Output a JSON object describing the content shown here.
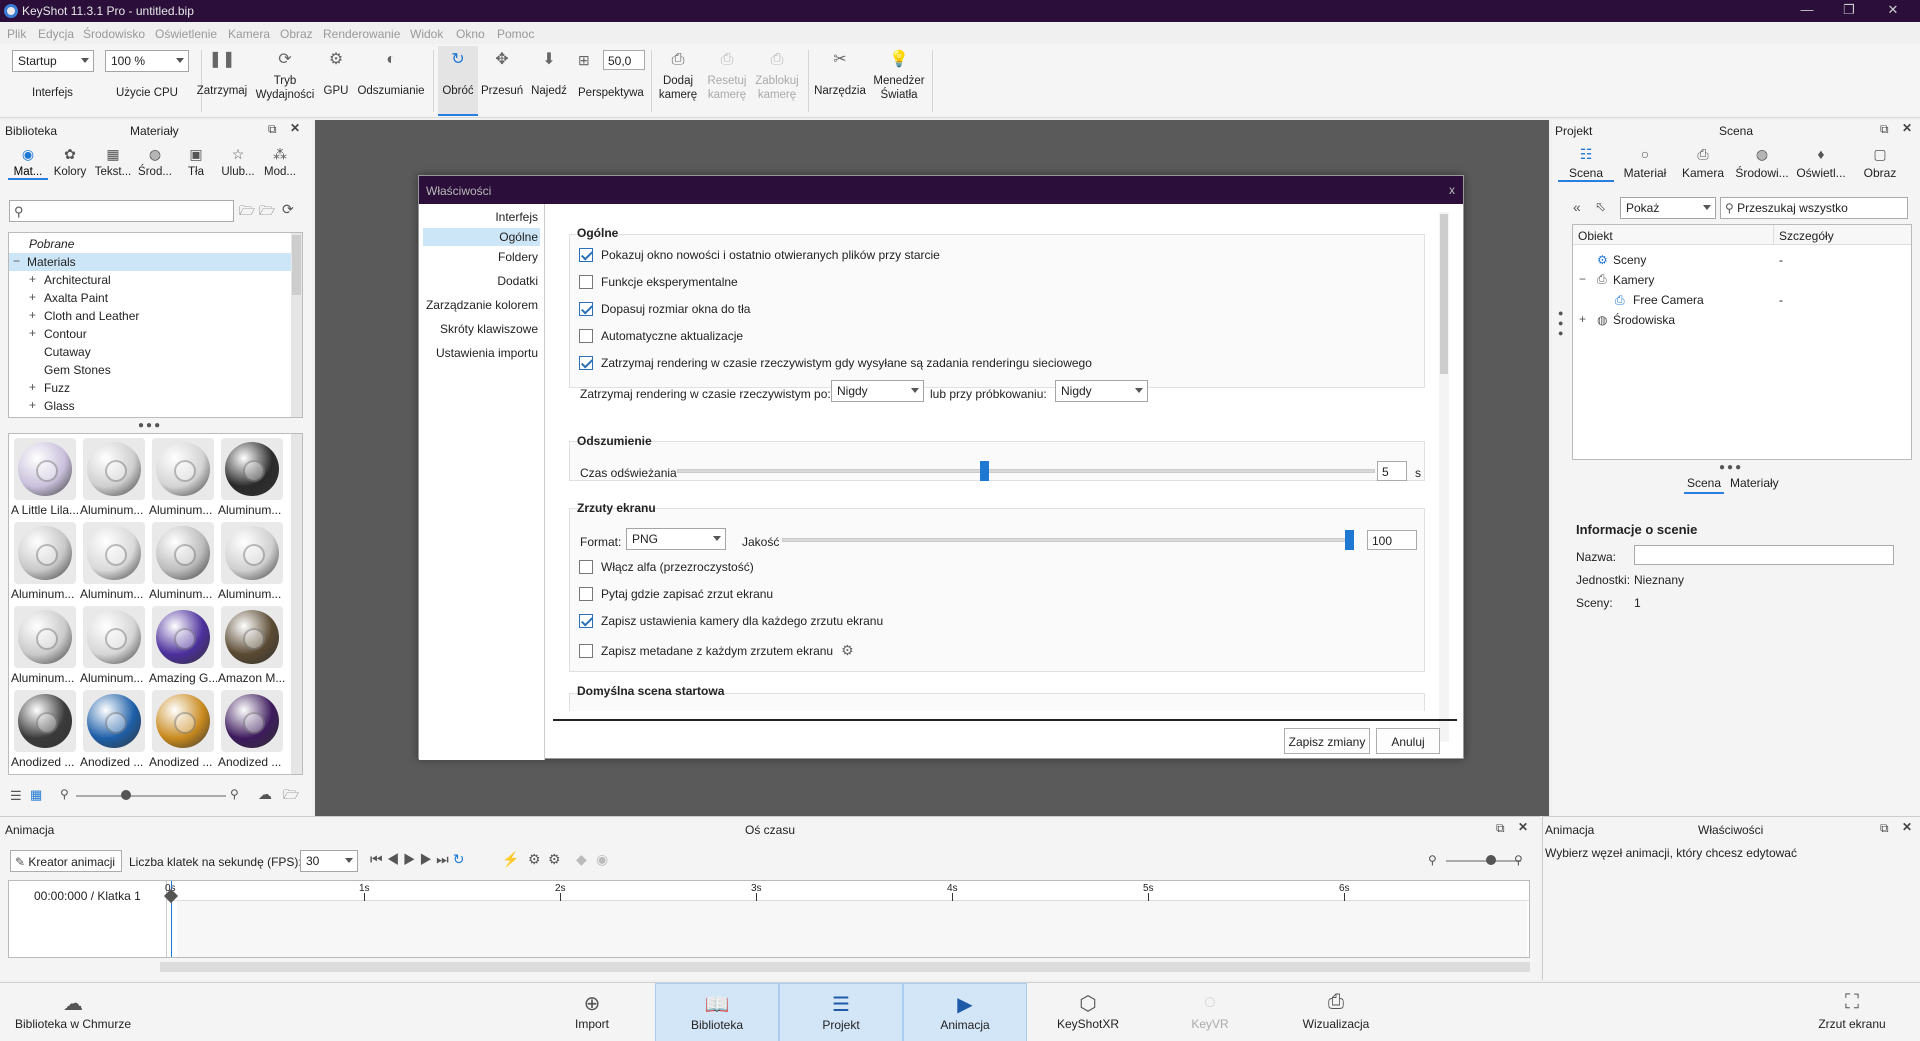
{
  "window": {
    "title": "KeyShot 11.3.1 Pro  - untitled.bip",
    "minimize": "—",
    "maximize": "❐",
    "close": "✕"
  },
  "menu": [
    "Plik",
    "Edycja",
    "Środowisko",
    "Oświetlenie",
    "Kamera",
    "Obraz",
    "Renderowanie",
    "Widok",
    "Okno",
    "Pomoc"
  ],
  "toolbar": {
    "workspace": "Startup",
    "zoom": "100 %",
    "perspective_value": "50,0",
    "buttons": {
      "interfejs": "Interfejs",
      "cpu": "Użycie CPU",
      "pause": "Zatrzymaj",
      "perf1": "Tryb",
      "perf2": "Wydajności",
      "gpu": "GPU",
      "denoise": "Odszumianie",
      "rotate": "Obróć",
      "pan": "Przesuń",
      "dolly": "Najedź",
      "perspective": "Perspektywa",
      "addcam1": "Dodaj",
      "addcam2": "kamerę",
      "resetcam1": "Resetuj",
      "resetcam2": "kamerę",
      "lockcam1": "Zablokuj",
      "lockcam2": "kamerę",
      "tools": "Narzędzia",
      "light1": "Menedżer",
      "light2": "Światła"
    }
  },
  "library": {
    "panel_title": "Biblioteka",
    "section_title": "Materiały",
    "tabs": [
      "Mat...",
      "Kolory",
      "Tekst...",
      "Środ...",
      "Tła",
      "Ulub...",
      "Mod..."
    ],
    "tree": [
      {
        "label": "Pobrane",
        "italic": true
      },
      {
        "label": "Materials",
        "selected": true
      },
      {
        "label": "Architectural",
        "expand": true
      },
      {
        "label": "Axalta Paint",
        "expand": true
      },
      {
        "label": "Cloth and Leather",
        "expand": true
      },
      {
        "label": "Contour",
        "expand": true
      },
      {
        "label": "Cutaway",
        "expand": false
      },
      {
        "label": "Gem Stones",
        "expand": false
      },
      {
        "label": "Fuzz",
        "expand": true
      },
      {
        "label": "Glass",
        "expand": true
      }
    ],
    "thumbnails": [
      {
        "label": "A Little Lila...",
        "color": "#c9c0db"
      },
      {
        "label": "Aluminum...",
        "color": "#cfcfcf"
      },
      {
        "label": "Aluminum...",
        "color": "#d4d4d4"
      },
      {
        "label": "Aluminum...",
        "color": "#2a2a2a"
      },
      {
        "label": "Aluminum...",
        "color": "#c8c8c8"
      },
      {
        "label": "Aluminum...",
        "color": "#d9d9d9"
      },
      {
        "label": "Aluminum...",
        "color": "#bdbdbd"
      },
      {
        "label": "Aluminum...",
        "color": "#d0d0d0"
      },
      {
        "label": "Aluminum...",
        "color": "#cacaca"
      },
      {
        "label": "Aluminum...",
        "color": "#d6d6d6"
      },
      {
        "label": "Amazing G...",
        "color": "#4b2f9c"
      },
      {
        "label": "Amazon M...",
        "color": "#5a4a32"
      },
      {
        "label": "Anodized ...",
        "color": "#3a3a3a"
      },
      {
        "label": "Anodized ...",
        "color": "#1d5fa8"
      },
      {
        "label": "Anodized ...",
        "color": "#c98a1e"
      },
      {
        "label": "Anodized ...",
        "color": "#3c1a5c"
      }
    ]
  },
  "dialog": {
    "title": "Właściwości",
    "close": "x",
    "nav": [
      "Interfejs",
      "Ogólne",
      "Foldery",
      "Dodatki",
      "Zarządzanie kolorem",
      "Skróty klawiszowe",
      "Ustawienia importu"
    ],
    "general": {
      "title": "Ogólne",
      "options": [
        {
          "label": "Pokazuj okno nowości i ostatnio otwieranych plików przy starcie",
          "checked": true
        },
        {
          "label": "Funkcje eksperymentalne",
          "checked": false
        },
        {
          "label": "Dopasuj rozmiar okna do tła",
          "checked": true
        },
        {
          "label": "Automatyczne aktualizacje",
          "checked": false
        },
        {
          "label": "Zatrzymaj rendering w czasie rzeczywistym gdy wysyłane są zadania renderingu sieciowego",
          "checked": true
        }
      ],
      "stop_after_label": "Zatrzymaj rendering w czasie rzeczywistym po:",
      "stop_after_value": "Nigdy",
      "or_samples_label": "lub przy próbkowaniu:",
      "or_samples_value": "Nigdy"
    },
    "denoise": {
      "title": "Odszumienie",
      "refresh_label": "Czas odświeżania",
      "refresh_value": "5",
      "refresh_unit": "s",
      "refresh_fraction": 0.44
    },
    "screenshots": {
      "title": "Zrzuty ekranu",
      "format_label": "Format:",
      "format_value": "PNG",
      "quality_label": "Jakość",
      "quality_value": "100",
      "quality_fraction": 1.0,
      "options": [
        {
          "label": "Włącz alfa (przezroczystość)",
          "checked": false
        },
        {
          "label": "Pytaj gdzie zapisać zrzut ekranu",
          "checked": false
        },
        {
          "label": "Zapisz ustawienia kamery dla każdego zrzutu ekranu",
          "checked": true
        },
        {
          "label": "Zapisz metadane z każdym zrzutem ekranu",
          "checked": false
        }
      ]
    },
    "startup_scene_title": "Domyślna scena startowa",
    "save_button": "Zapisz zmiany",
    "cancel_button": "Anuluj"
  },
  "project": {
    "panel_title": "Projekt",
    "section_title": "Scena",
    "tabs": [
      "Scena",
      "Materiał",
      "Kamera",
      "Środowi...",
      "Oświetl...",
      "Obraz"
    ],
    "filter_value": "Pokaż",
    "search_placeholder": "Przeszukaj wszystko",
    "columns": [
      "Obiekt",
      "Szczegóły"
    ],
    "tree": [
      {
        "label": "Sceny",
        "detail": "-"
      },
      {
        "label": "Kamery",
        "detail": ""
      },
      {
        "label": "Free Camera",
        "detail": "-"
      },
      {
        "label": "Środowiska",
        "detail": ""
      }
    ],
    "subtabs": [
      "Scena",
      "Materiały"
    ],
    "info_title": "Informacje o scenie",
    "name_label": "Nazwa:",
    "name_value": "",
    "units_label": "Jednostki:",
    "units_value": "Nieznany",
    "scenes_label": "Sceny:",
    "scenes_value": "1"
  },
  "animation": {
    "panel_title": "Animacja",
    "timeline_title": "Oś czasu",
    "wizard_button": "Kreator animacji",
    "fps_label": "Liczba klatek na sekundę (FPS):",
    "fps_value": "30",
    "time_display": "00:00:000 / Klatka 1",
    "ticks": [
      "0s",
      "1s",
      "2s",
      "3s",
      "4s",
      "5s",
      "6s"
    ]
  },
  "anim_props": {
    "panel_title": "Animacja",
    "section_title": "Właściwości",
    "hint": "Wybierz węzeł animacji, który chcesz edytować"
  },
  "bottombar": {
    "cloud": "Biblioteka w Chmurze",
    "import": "Import",
    "library": "Biblioteka",
    "project": "Projekt",
    "animation": "Animacja",
    "xr": "KeyShotXR",
    "vr": "KeyVR",
    "viz": "Wizualizacja",
    "screenshot": "Zrzut ekranu"
  },
  "colors": {
    "accent": "#1e78d2",
    "titlebar": "#2b0f3a",
    "selection": "#cde6f7",
    "viewport": "#5a5a5a"
  }
}
